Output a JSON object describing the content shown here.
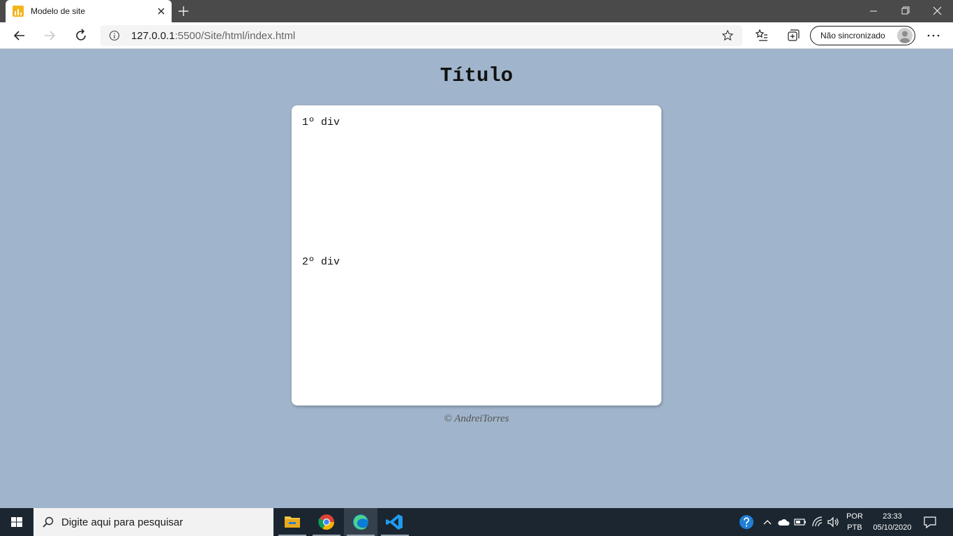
{
  "browser": {
    "tab": {
      "title": "Modelo de site"
    },
    "address": {
      "host": "127.0.0.1",
      "rest": ":5500/Site/html/index.html"
    },
    "profile": {
      "label": "Não sincronizado"
    }
  },
  "page": {
    "title": "Título",
    "divs": [
      "1º div",
      "2º div"
    ],
    "footer": "© AndreiTorres"
  },
  "taskbar": {
    "search_placeholder": "Digite aqui para pesquisar",
    "lang_top": "POR",
    "lang_bottom": "PTB",
    "time": "23:33",
    "date": "05/10/2020"
  }
}
